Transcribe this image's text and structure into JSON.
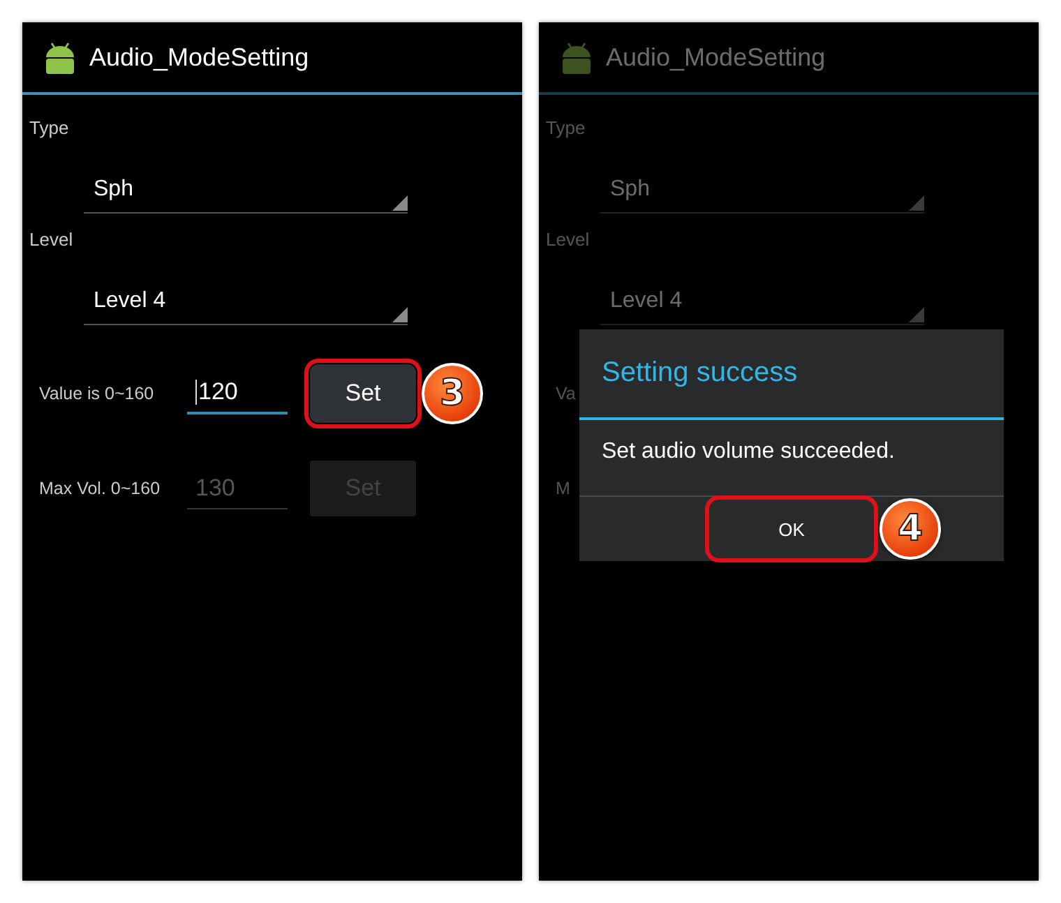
{
  "screens": [
    {
      "title": "Audio_ModeSetting",
      "dimmed": false,
      "fields": [
        {
          "label": "Type",
          "value": "Sph"
        },
        {
          "label": "Level",
          "value": "Level 4"
        }
      ],
      "rows": [
        {
          "label": "Value is 0~160",
          "value": "120",
          "focused": true,
          "disabled": false,
          "button": "Set",
          "highlighted": true,
          "callout": "3"
        },
        {
          "label": "Max Vol. 0~160",
          "value": "130",
          "focused": false,
          "disabled": true,
          "button": "Set",
          "highlighted": false
        }
      ]
    },
    {
      "title": "Audio_ModeSetting",
      "dimmed": true,
      "fields": [
        {
          "label": "Type",
          "value": "Sph"
        },
        {
          "label": "Level",
          "value": "Level 4"
        }
      ],
      "rows": [
        {
          "label": "Va"
        },
        {
          "label": "M"
        }
      ],
      "dialog": {
        "title": "Setting success",
        "message": "Set audio volume succeeded.",
        "button": "OK",
        "highlighted": true,
        "callout": "4"
      }
    }
  ]
}
